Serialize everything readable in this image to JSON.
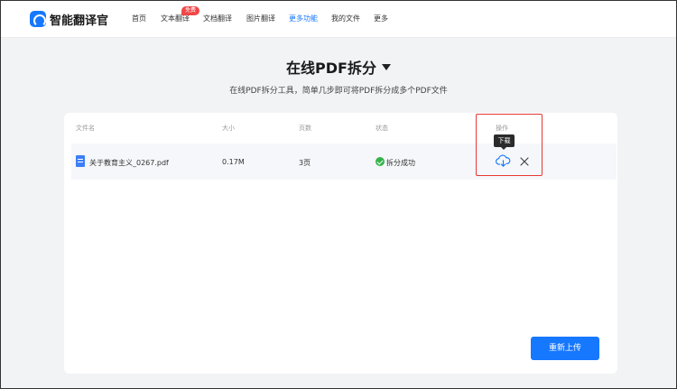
{
  "app": {
    "name": "智能翻译官",
    "logo_icon": "app-logo-icon"
  },
  "nav": {
    "items": [
      {
        "label": "首页",
        "active": false
      },
      {
        "label": "文本翻译",
        "active": false,
        "badge": "免费"
      },
      {
        "label": "文档翻译",
        "active": false
      },
      {
        "label": "图片翻译",
        "active": false
      },
      {
        "label": "更多功能",
        "active": true
      },
      {
        "label": "我的文件",
        "active": false
      },
      {
        "label": "更多",
        "active": false
      }
    ]
  },
  "page": {
    "title": "在线PDF拆分",
    "subtitle": "在线PDF拆分工具，简单几步即可将PDF拆分成多个PDF文件"
  },
  "table": {
    "headers": [
      "文件名",
      "大小",
      "页数",
      "状态",
      "操作"
    ],
    "rows": [
      {
        "file_name": "关于教育主义_0267.pdf",
        "size": "0.17M",
        "pages": "3页",
        "status": "拆分成功"
      }
    ]
  },
  "tooltip": {
    "download": "下载"
  },
  "actions": {
    "reupload_label": "重新上传"
  },
  "colors": {
    "accent": "#1677ff",
    "success": "#35b34a",
    "highlight": "#e53935",
    "badge": "#f04747"
  }
}
